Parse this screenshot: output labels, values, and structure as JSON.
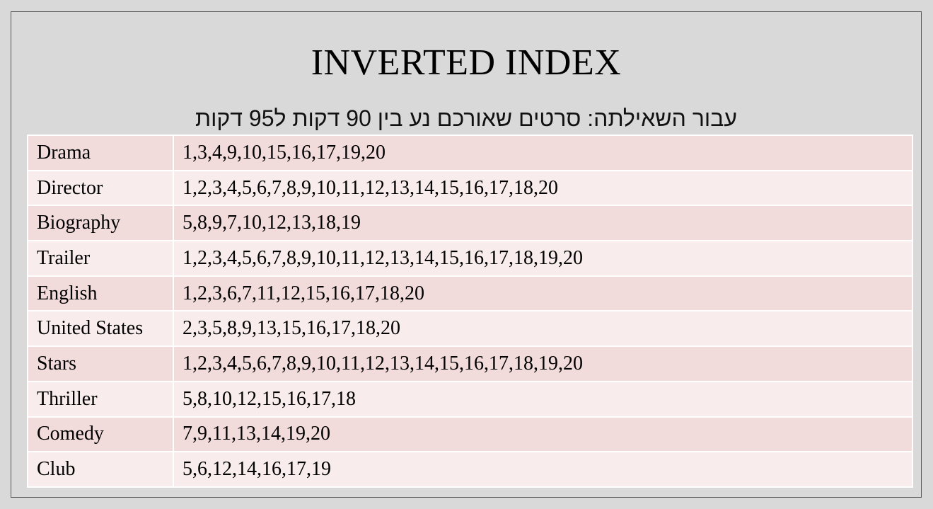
{
  "title": "INVERTED INDEX",
  "subtitle": "עבור השאילתה: סרטים שאורכם נע בין 90 דקות ל95 דקות",
  "rows": [
    {
      "term": "Drama",
      "postings": "1,3,4,9,10,15,16,17,19,20"
    },
    {
      "term": "Director",
      "postings": "1,2,3,4,5,6,7,8,9,10,11,12,13,14,15,16,17,18,20"
    },
    {
      "term": "Biography",
      "postings": "5,8,9,7,10,12,13,18,19"
    },
    {
      "term": "Trailer",
      "postings": "1,2,3,4,5,6,7,8,9,10,11,12,13,14,15,16,17,18,19,20"
    },
    {
      "term": "English",
      "postings": "1,2,3,6,7,11,12,15,16,17,18,20"
    },
    {
      "term": "United States",
      "postings": "2,3,5,8,9,13,15,16,17,18,20"
    },
    {
      "term": "Stars",
      "postings": "1,2,3,4,5,6,7,8,9,10,11,12,13,14,15,16,17,18,19,20"
    },
    {
      "term": "Thriller",
      "postings": "5,8,10,12,15,16,17,18"
    },
    {
      "term": "Comedy",
      "postings": "7,9,11,13,14,19,20"
    },
    {
      "term": "Club",
      "postings": "5,6,12,14,16,17,19"
    }
  ],
  "colors": {
    "background": "#d9d9d9",
    "row_dark": "#f2dcdb",
    "row_light": "#f8edec",
    "cell_border": "#ffffff"
  }
}
